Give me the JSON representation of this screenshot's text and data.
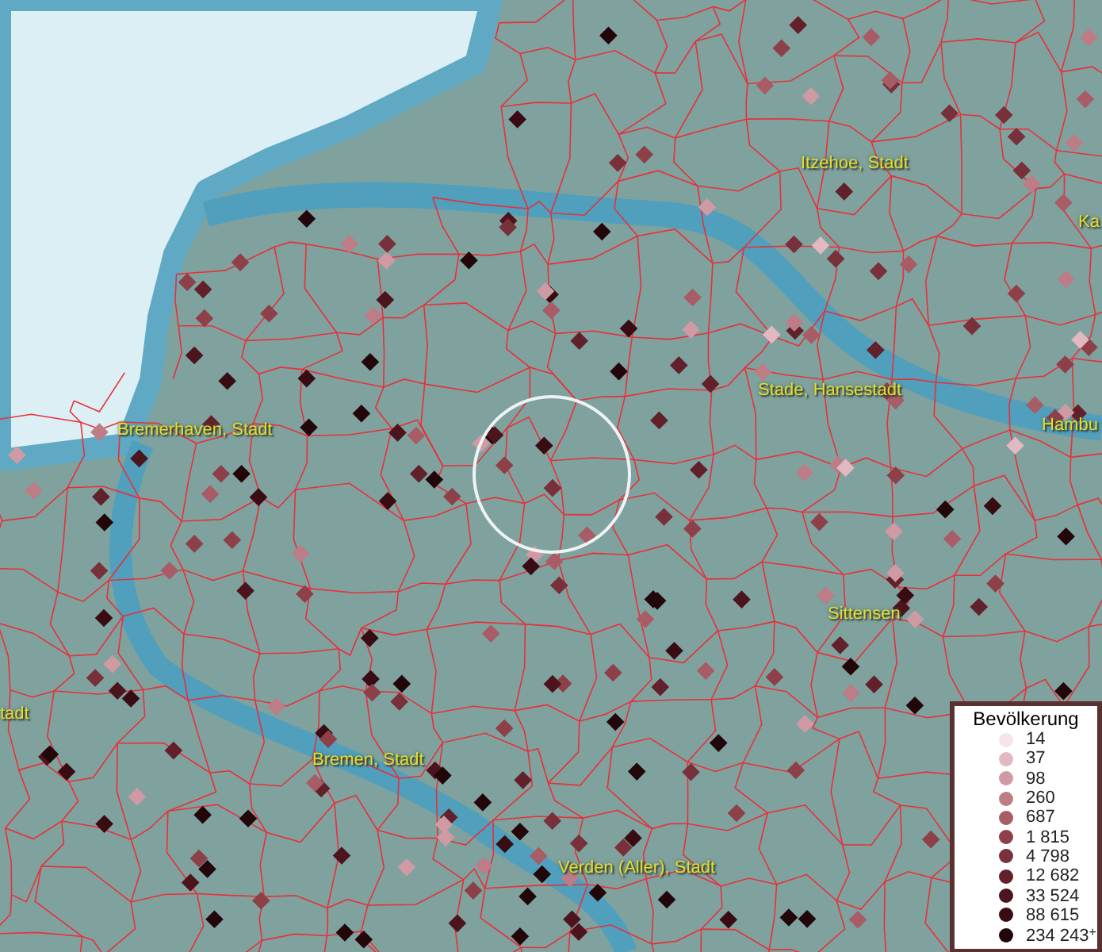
{
  "map_labels": [
    {
      "text": "Itzehoe, Stadt"
    },
    {
      "text": "Ka"
    },
    {
      "text": "Stade, Hansestadt"
    },
    {
      "text": "Bremerhaven, Stadt"
    },
    {
      "text": "Hambu"
    },
    {
      "text": "Sittensen"
    },
    {
      "text": "tadt"
    },
    {
      "text": "Bremen, Stadt"
    },
    {
      "text": "Verden (Aller), Stadt"
    }
  ],
  "legend": {
    "title": "Bevölkerung",
    "items": [
      {
        "label": "14",
        "color": "#f6e4ec"
      },
      {
        "label": "37",
        "color": "#e2b8c2"
      },
      {
        "label": "98",
        "color": "#d09aa4"
      },
      {
        "label": "260",
        "color": "#bd7c86"
      },
      {
        "label": "687",
        "color": "#a85c66"
      },
      {
        "label": "1 815",
        "color": "#8e4048"
      },
      {
        "label": "4 798",
        "color": "#78303a"
      },
      {
        "label": "12 682",
        "color": "#62202a"
      },
      {
        "label": "33 524",
        "color": "#4c141c"
      },
      {
        "label": "88 615",
        "color": "#380c12"
      },
      {
        "label": "234 243$^{+}$",
        "color": "#22060a"
      }
    ]
  }
}
